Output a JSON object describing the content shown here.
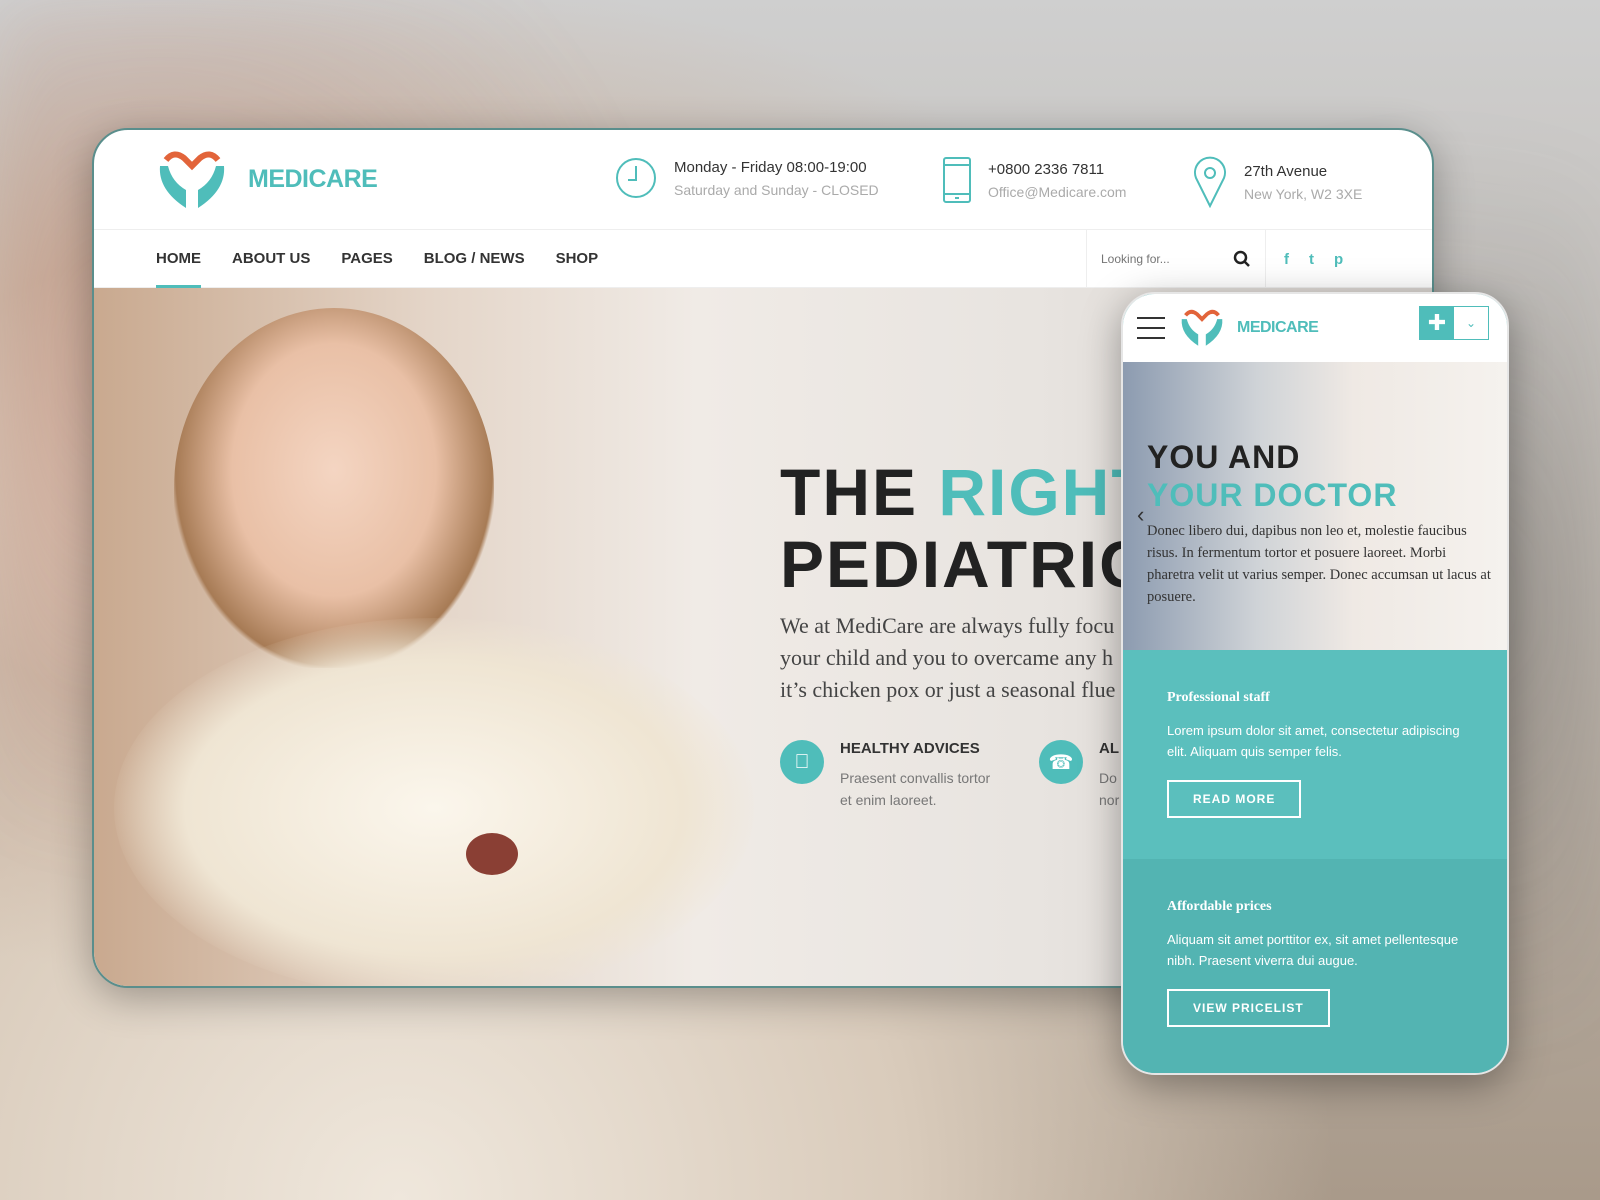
{
  "colors": {
    "accent": "#4fbdba",
    "logo_orange": "#e2643a",
    "text": "#333333"
  },
  "brand": "MEDICARE",
  "header": {
    "hours": {
      "icon": "clock-icon",
      "line1": "Monday - Friday 08:00-19:00",
      "line2": "Saturday and Sunday - CLOSED"
    },
    "contact": {
      "icon": "phone-icon",
      "line1": "+0800 2336 7811",
      "line2": "Office@Medicare.com"
    },
    "address": {
      "icon": "map-pin-icon",
      "line1": "27th Avenue",
      "line2": "New York, W2 3XE"
    }
  },
  "nav": {
    "items": [
      {
        "label": "HOME",
        "active": true
      },
      {
        "label": "ABOUT US"
      },
      {
        "label": "PAGES"
      },
      {
        "label": "BLOG / NEWS"
      },
      {
        "label": "SHOP"
      }
    ],
    "search_placeholder": "Looking for...",
    "social": [
      "f",
      "t",
      "p"
    ]
  },
  "hero": {
    "title_a": "THE ",
    "title_b": "RIGHT",
    "title_c": "PEDIATRIC",
    "lead": [
      "We at MediCare are always fully focu",
      "your child and you to overcame any h",
      "it’s chicken pox or just a seasonal flue"
    ],
    "features": [
      {
        "icon": "apple-icon",
        "title": "HEALTHY ADVICES",
        "desc": [
          "Praesent convallis tortor",
          "et enim laoreet."
        ]
      },
      {
        "icon": "stethoscope-phone-icon",
        "title": "AL",
        "desc": [
          "Do",
          "nor"
        ]
      }
    ]
  },
  "mobile": {
    "brand": "MEDICARE",
    "hero_line1": "YOU AND",
    "hero_line2": "YOUR DOCTOR",
    "hero_text": "Donec libero dui, dapibus non leo et, molestie faucibus risus. In fermentum tortor et posuere laoreet. Morbi pharetra velit ut varius semper. Donec accumsan ut lacus at posuere.",
    "cards": [
      {
        "title": "Professional staff",
        "desc": "Lorem ipsum dolor sit amet, consectetur adipiscing elit. Aliquam quis semper felis.",
        "button": "READ MORE"
      },
      {
        "title": "Affordable prices",
        "desc": "Aliquam sit amet porttitor ex, sit amet pellentesque nibh. Praesent viverra dui augue.",
        "button": "VIEW PRICELIST"
      }
    ]
  }
}
